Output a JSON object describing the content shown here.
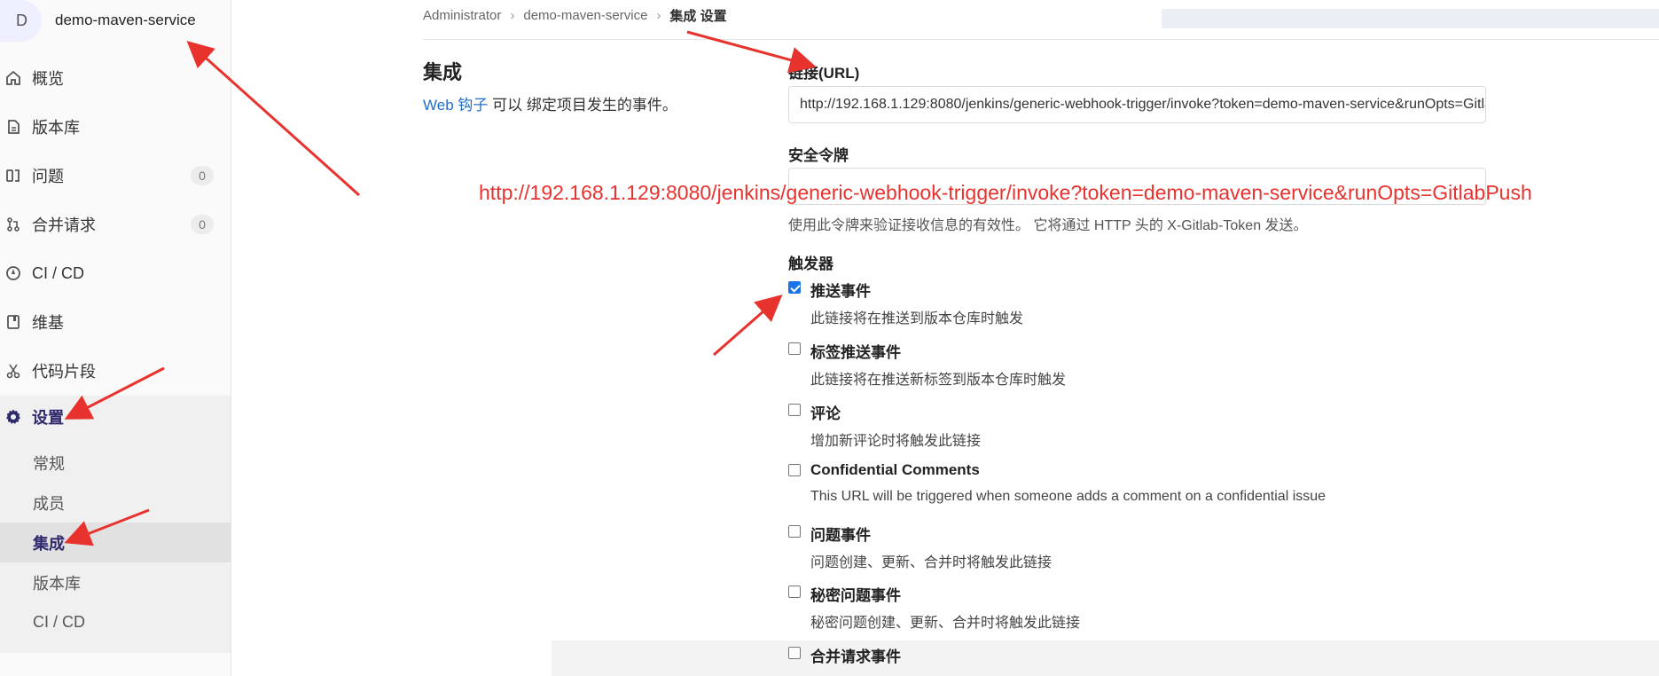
{
  "project": {
    "avatar_letter": "D",
    "name": "demo-maven-service"
  },
  "nav": [
    {
      "label": "概览",
      "icon": "home-icon"
    },
    {
      "label": "版本库",
      "icon": "document-icon"
    },
    {
      "label": "问题",
      "icon": "issues-icon",
      "count": "0"
    },
    {
      "label": "合并请求",
      "icon": "merge-request-icon",
      "count": "0"
    },
    {
      "label": "CI / CD",
      "icon": "rocket-icon"
    },
    {
      "label": "维基",
      "icon": "book-icon"
    },
    {
      "label": "代码片段",
      "icon": "scissors-icon"
    },
    {
      "label": "设置",
      "icon": "gear-icon"
    }
  ],
  "settings_sub": [
    {
      "label": "常规"
    },
    {
      "label": "成员"
    },
    {
      "label": "集成"
    },
    {
      "label": "版本库"
    },
    {
      "label": "CI / CD"
    }
  ],
  "breadcrumb": {
    "root": "Administrator",
    "project": "demo-maven-service",
    "current": "集成 设置"
  },
  "section": {
    "title": "集成",
    "link": "Web 钩子",
    "desc": "可以 绑定项目发生的事件。"
  },
  "form": {
    "url_label": "链接(URL)",
    "url_value": "http://192.168.1.129:8080/jenkins/generic-webhook-trigger/invoke?token=demo-maven-service&runOpts=GitlabPush",
    "token_label": "安全令牌",
    "token_help": "使用此令牌来验证接收信息的有效性。 它将通过 HTTP 头的 X-Gitlab-Token 发送。",
    "triggers_label": "触发器"
  },
  "overlay_url": "http://192.168.1.129:8080/jenkins/generic-webhook-trigger/invoke?token=demo-maven-service&runOpts=GitlabPush",
  "triggers": [
    {
      "title": "推送事件",
      "desc": "此链接将在推送到版本仓库时触发",
      "checked": true
    },
    {
      "title": "标签推送事件",
      "desc": "此链接将在推送新标签到版本仓库时触发",
      "checked": false
    },
    {
      "title": "评论",
      "desc": "增加新评论时将触发此链接",
      "checked": false
    },
    {
      "title": "Confidential Comments",
      "desc": "This URL will be triggered when someone adds a comment on a confidential issue",
      "checked": false
    },
    {
      "title": "问题事件",
      "desc": "问题创建、更新、合并时将触发此链接",
      "checked": false
    },
    {
      "title": "秘密问题事件",
      "desc": "秘密问题创建、更新、合并时将触发此链接",
      "checked": false
    },
    {
      "title": "合并请求事件",
      "desc": "",
      "checked": false
    }
  ],
  "colors": {
    "accent": "#2f2a6b",
    "link": "#1f6fc9",
    "annotation": "#e8322e"
  }
}
